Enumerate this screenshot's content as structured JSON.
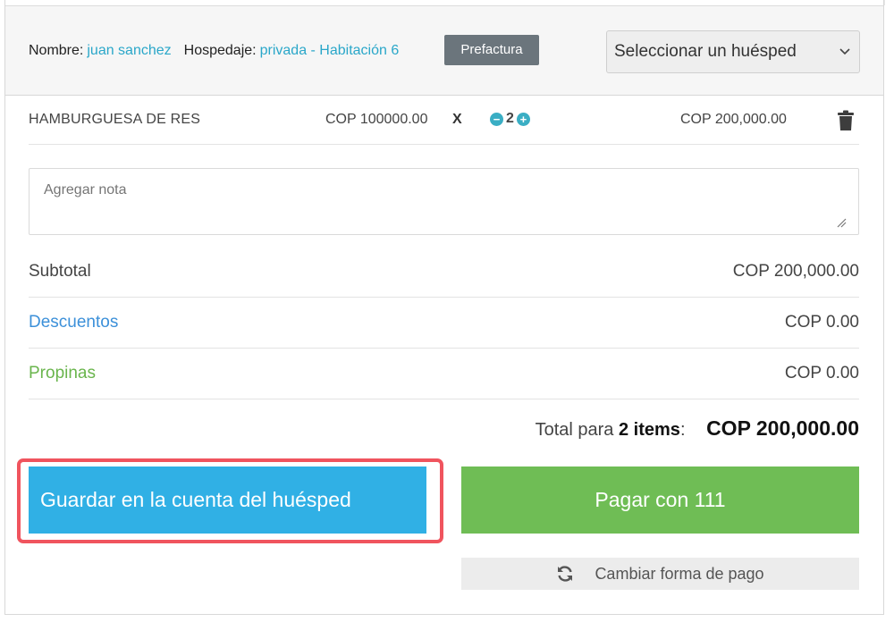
{
  "header": {
    "name_label": "Nombre:",
    "name_value": "juan sanchez",
    "lodging_label": "Hospedaje:",
    "lodging_value": "privada - Habitación 6",
    "prefactura_label": "Prefactura",
    "guest_select_value": "Seleccionar un huésped"
  },
  "item": {
    "name": "HAMBURGUESA DE RES",
    "unit_price": "COP 100000.00",
    "multiply": "X",
    "quantity": "2",
    "total": "COP 200,000.00"
  },
  "note": {
    "placeholder": "Agregar nota"
  },
  "summary": {
    "subtotal_label": "Subtotal",
    "subtotal_value": "COP 200,000.00",
    "discounts_label": "Descuentos",
    "discounts_value": "COP 0.00",
    "tips_label": "Propinas",
    "tips_value": "COP 0.00"
  },
  "total": {
    "prefix": "Total para",
    "count": "2 items",
    "colon": ":",
    "amount": "COP 200,000.00"
  },
  "buttons": {
    "save_label": "Guardar en la cuenta del huésped",
    "pay_label": "Pagar con 111",
    "change_label": "Cambiar forma de pago"
  },
  "icons": {
    "minus": "minus-circle-icon",
    "plus": "plus-circle-icon",
    "trash": "trash-icon",
    "refresh": "refresh-icon",
    "chevron": "chevron-down-icon"
  },
  "colors": {
    "link": "#2aa7c9",
    "save_button": "#30b0e5",
    "pay_button": "#6fbd55",
    "highlight": "#f0545e",
    "discounts": "#3c90d9",
    "tips": "#6ab54d"
  }
}
